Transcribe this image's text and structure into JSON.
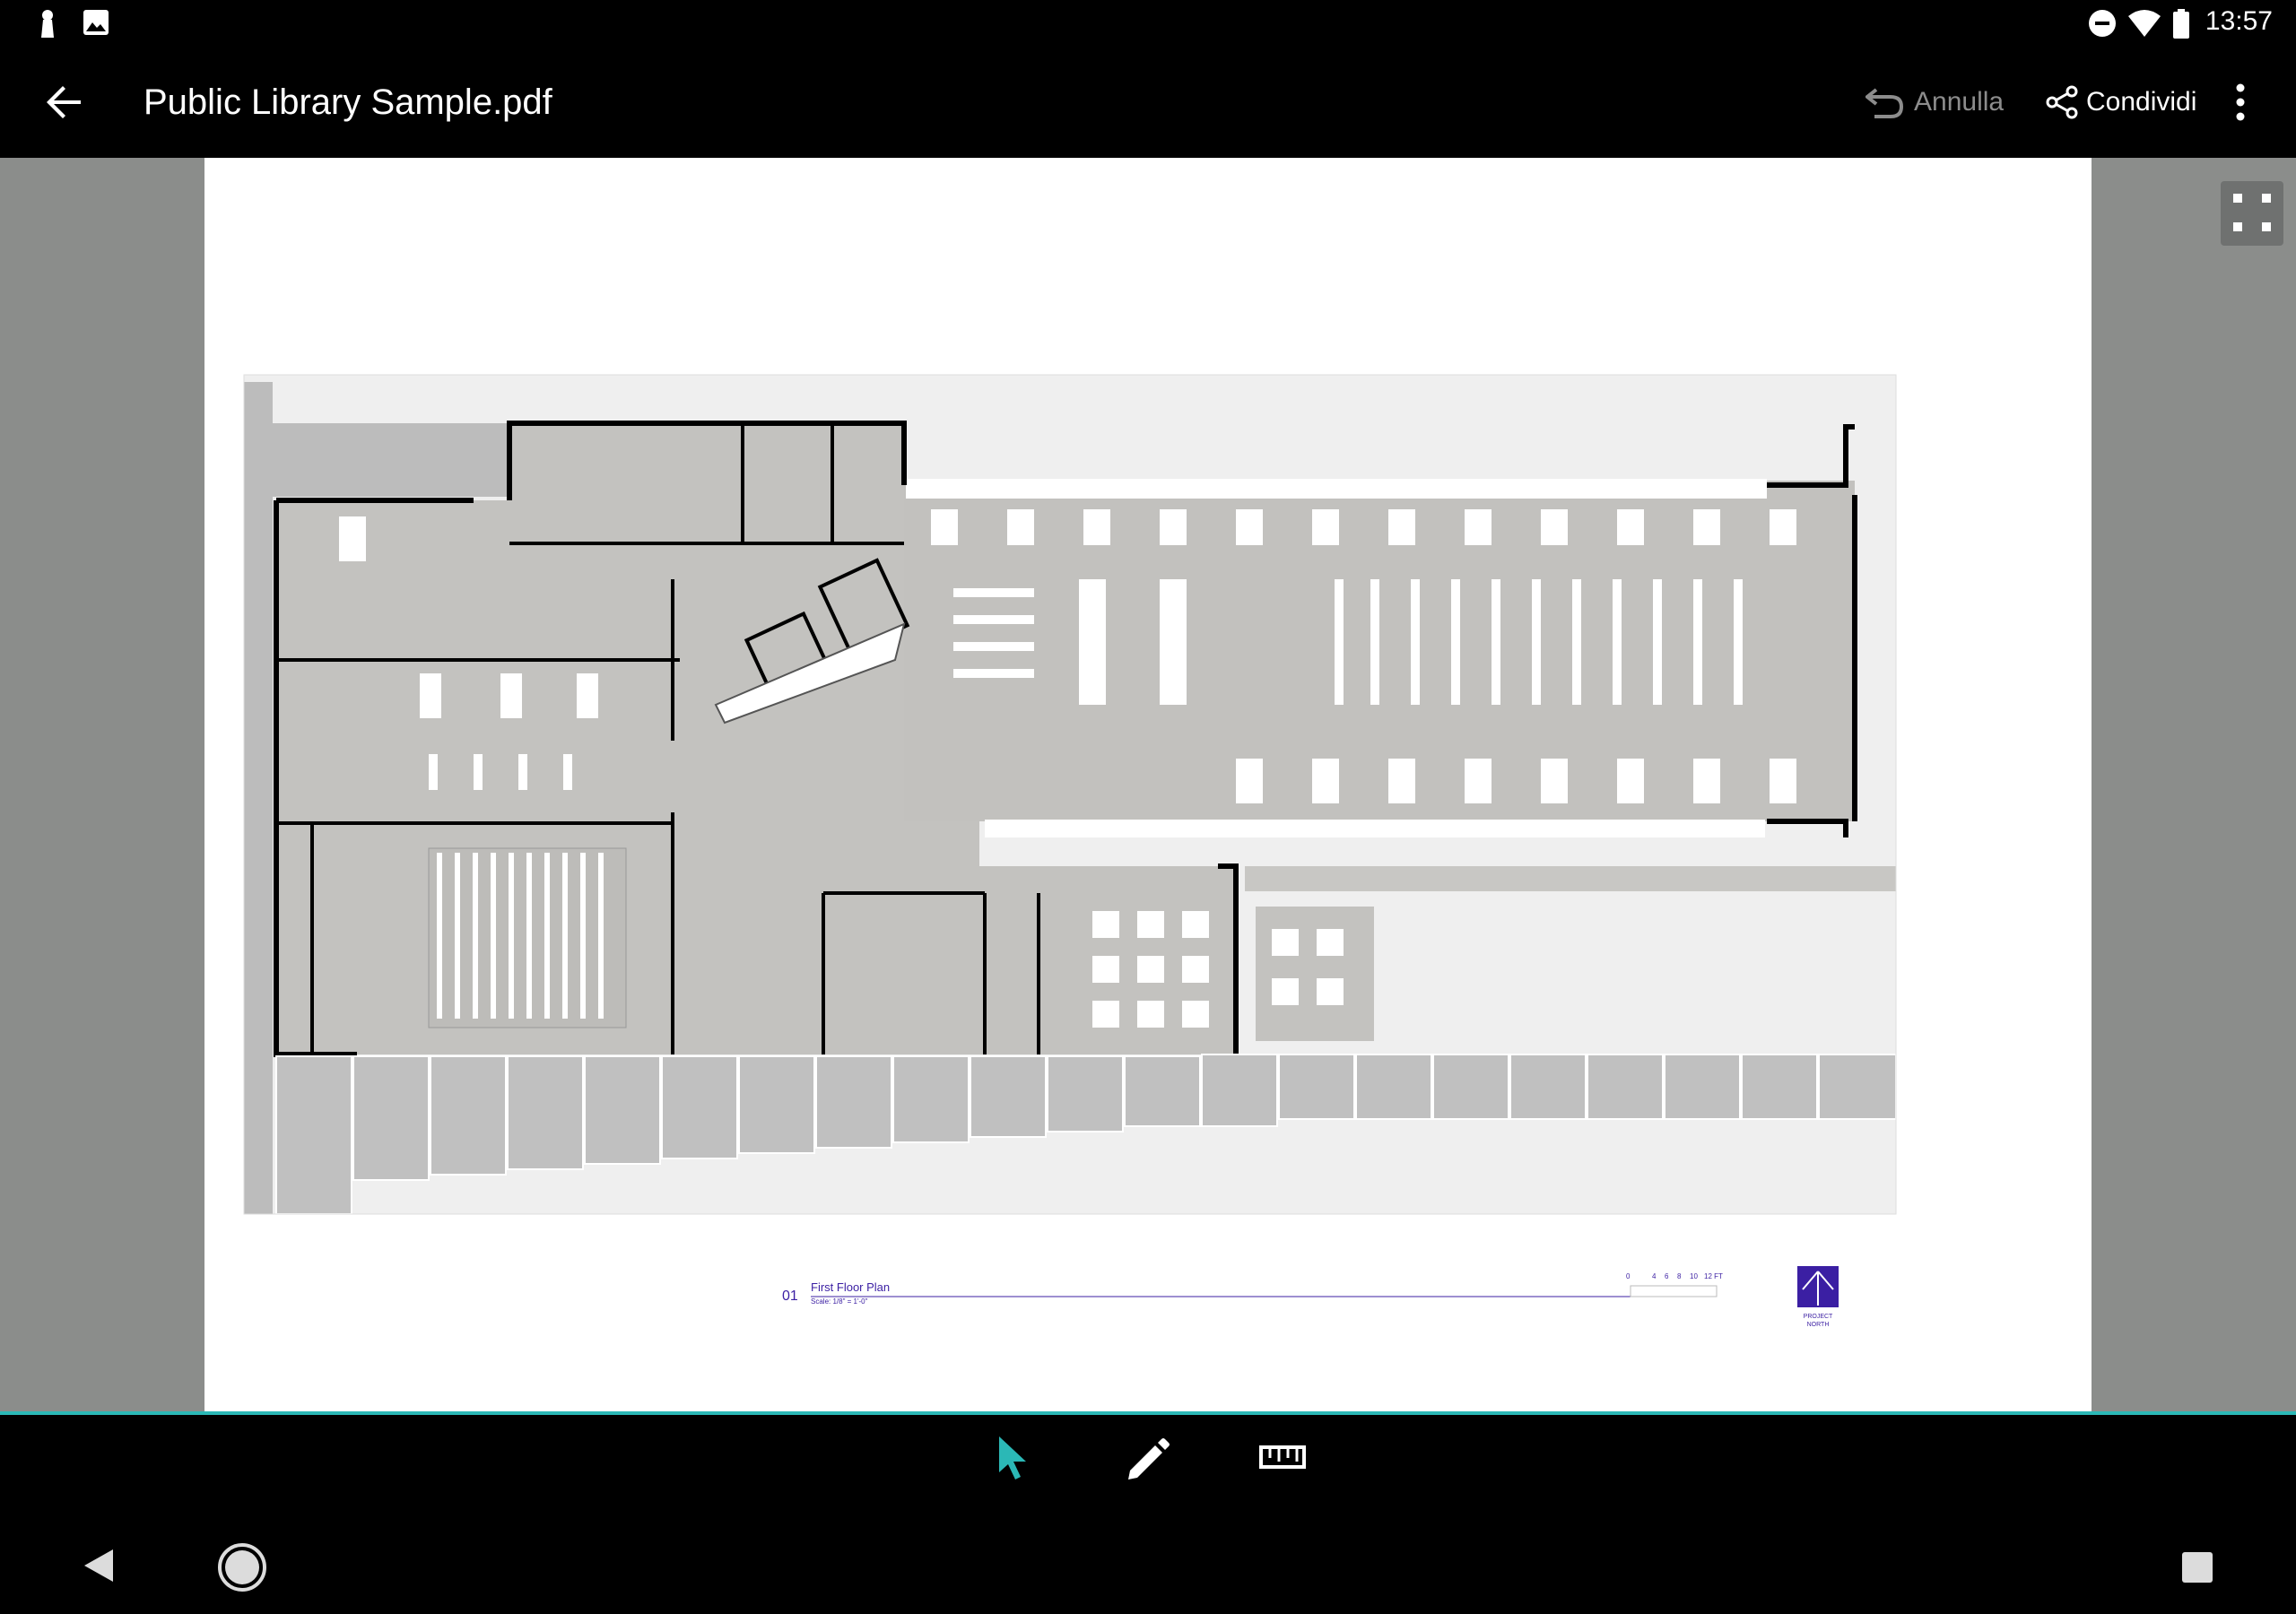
{
  "status_bar": {
    "time": "13:57"
  },
  "app_bar": {
    "title": "Public Library Sample.pdf",
    "undo_label": "Annulla",
    "share_label": "Condividi"
  },
  "drawing": {
    "plan_number": "01",
    "plan_title": "First Floor Plan",
    "plan_scale": "Scale: 1/8\" = 1'-0\"",
    "scale_bar_ticks": [
      "0",
      "4",
      "6",
      "8",
      "10",
      "12 FT"
    ],
    "north_label_line1": "PROJECT",
    "north_label_line2": "NORTH",
    "accent_color": "#3b1fa3"
  },
  "bottom_toolbar": {
    "selected_tool": "select",
    "accent_color": "#2bb8b6"
  }
}
